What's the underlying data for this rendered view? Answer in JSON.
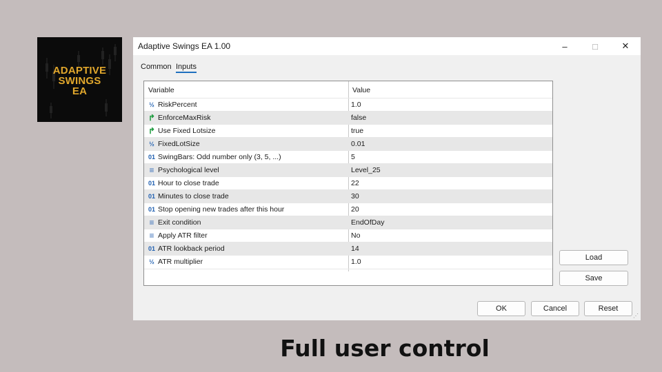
{
  "logo": {
    "lines": [
      "ADAPTIVE",
      "SWINGS",
      "EA"
    ]
  },
  "window": {
    "title": "Adaptive Swings EA 1.00",
    "controls": {
      "minimize": "–",
      "maximize": "□",
      "close": "✕"
    }
  },
  "tabs": [
    {
      "label": "Common"
    },
    {
      "label": "Inputs",
      "active": true
    }
  ],
  "table": {
    "headers": {
      "variable": "Variable",
      "value": "Value"
    },
    "rows": [
      {
        "icon": "fraction-icon",
        "glyph": "½",
        "name": "RiskPercent",
        "value": "1.0"
      },
      {
        "icon": "bool-arrow-icon",
        "glyph": "↱",
        "name": "EnforceMaxRisk",
        "value": "false"
      },
      {
        "icon": "bool-arrow-icon",
        "glyph": "↱",
        "name": "Use Fixed Lotsize",
        "value": "true"
      },
      {
        "icon": "fraction-icon",
        "glyph": "½",
        "name": "FixedLotSize",
        "value": "0.01"
      },
      {
        "icon": "integer-icon",
        "glyph": "01",
        "name": "SwingBars: Odd number only (3, 5, ...)",
        "value": "5"
      },
      {
        "icon": "enum-icon",
        "glyph": "≡",
        "name": "Psychological level",
        "value": "Level_25"
      },
      {
        "icon": "integer-icon",
        "glyph": "01",
        "name": "Hour to close trade",
        "value": "22"
      },
      {
        "icon": "integer-icon",
        "glyph": "01",
        "name": "Minutes to close trade",
        "value": "30"
      },
      {
        "icon": "integer-icon",
        "glyph": "01",
        "name": "Stop opening new trades after this hour",
        "value": "20"
      },
      {
        "icon": "enum-icon",
        "glyph": "≡",
        "name": "Exit condition",
        "value": "EndOfDay"
      },
      {
        "icon": "enum-icon",
        "glyph": "≡",
        "name": "Apply ATR filter",
        "value": "No"
      },
      {
        "icon": "integer-icon",
        "glyph": "01",
        "name": "ATR lookback period",
        "value": "14"
      },
      {
        "icon": "fraction-icon",
        "glyph": "½",
        "name": "ATR multiplier",
        "value": "1.0"
      }
    ]
  },
  "side_buttons": {
    "load": "Load",
    "save": "Save"
  },
  "bottom_buttons": {
    "ok": "OK",
    "cancel": "Cancel",
    "reset": "Reset"
  },
  "caption": "Full user control",
  "colors": {
    "background": "#c4bcbc",
    "logo_text": "#e1a72c",
    "tab_accent": "#1f6fbf",
    "icon_blue": "#1f5fb0",
    "icon_green": "#1b9a3c"
  }
}
